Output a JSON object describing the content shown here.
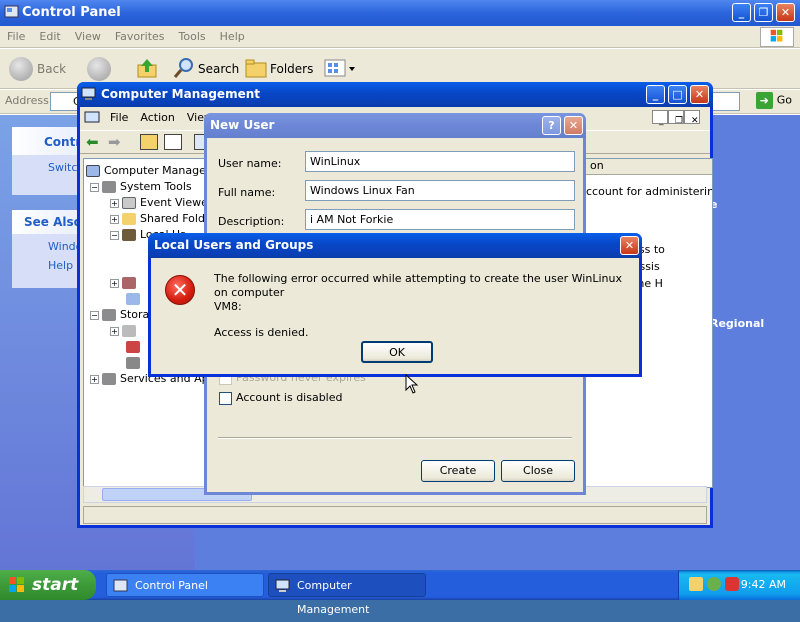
{
  "control_panel": {
    "title": "Control Panel",
    "menu": [
      "File",
      "Edit",
      "View",
      "Favorites",
      "Tools",
      "Help"
    ],
    "toolbar": {
      "back": "Back",
      "search": "Search",
      "folders": "Folders"
    },
    "address_label": "Address",
    "address_value": "C",
    "go_label": "Go",
    "panel_title": "Contro",
    "panel_link": "Switch",
    "see_also": "See Also",
    "see_also_links": [
      "Windo",
      "Help a"
    ],
    "right_text": [
      "e",
      "Regional"
    ]
  },
  "computer_management": {
    "title": "Computer Management",
    "menu": [
      "File",
      "Action",
      "View"
    ],
    "tree": {
      "root": "Computer Manageme",
      "system_tools": "System Tools",
      "event_viewer": "Event Viewe",
      "shared_folders": "Shared Folde",
      "local_users": "Local Us",
      "storage": "Stora",
      "services": "Services and Ap"
    },
    "list": {
      "header": "on",
      "rows": [
        "ccount for administering th",
        "uest access to",
        "Remote Assis",
        "ount for the H"
      ]
    }
  },
  "new_user": {
    "title": "New User",
    "username_label": "User name:",
    "username": "WinLinux",
    "fullname_label": "Full name:",
    "fullname": "Windows Linux Fan",
    "description_label": "Description:",
    "description": "i AM Not Forkie",
    "password_never_expires": "Password never expires",
    "account_disabled": "Account is disabled",
    "create": "Create",
    "close": "Close"
  },
  "error_dialog": {
    "title": "Local Users and Groups",
    "message_line1": "The following error occurred while attempting to create the user WinLinux on computer",
    "message_line2": "VM8:",
    "message_line3": "Access is denied.",
    "ok": "OK"
  },
  "taskbar": {
    "start": "start",
    "tasks": [
      "Control Panel",
      "Computer Management"
    ],
    "clock": "9:42 AM"
  }
}
